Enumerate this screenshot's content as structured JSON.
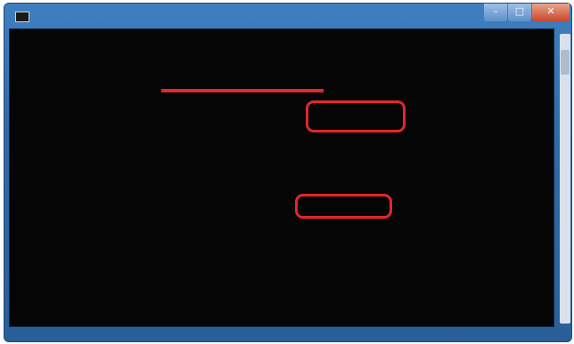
{
  "window": {
    "title": "",
    "controls": {
      "minimize": "–",
      "maximize": "□",
      "close": "✕"
    }
  },
  "console": {
    "lines": []
  },
  "annotations": {
    "highlight_color": "#e3262c",
    "box1_text": "",
    "box2_text": ""
  }
}
